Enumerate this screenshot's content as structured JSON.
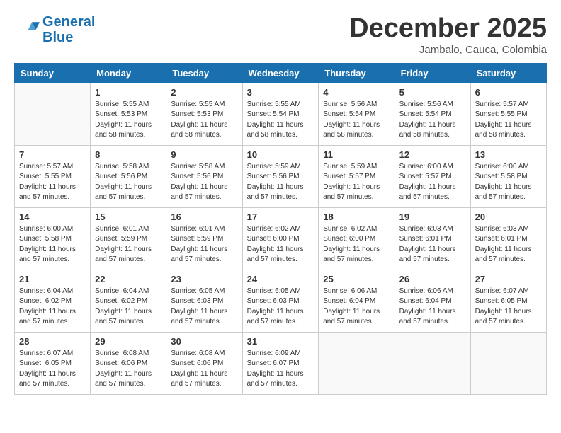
{
  "header": {
    "logo_line1": "General",
    "logo_line2": "Blue",
    "month_title": "December 2025",
    "location": "Jambalo, Cauca, Colombia"
  },
  "weekdays": [
    "Sunday",
    "Monday",
    "Tuesday",
    "Wednesday",
    "Thursday",
    "Friday",
    "Saturday"
  ],
  "weeks": [
    [
      {
        "day": "",
        "info": ""
      },
      {
        "day": "1",
        "info": "Sunrise: 5:55 AM\nSunset: 5:53 PM\nDaylight: 11 hours\nand 58 minutes."
      },
      {
        "day": "2",
        "info": "Sunrise: 5:55 AM\nSunset: 5:53 PM\nDaylight: 11 hours\nand 58 minutes."
      },
      {
        "day": "3",
        "info": "Sunrise: 5:55 AM\nSunset: 5:54 PM\nDaylight: 11 hours\nand 58 minutes."
      },
      {
        "day": "4",
        "info": "Sunrise: 5:56 AM\nSunset: 5:54 PM\nDaylight: 11 hours\nand 58 minutes."
      },
      {
        "day": "5",
        "info": "Sunrise: 5:56 AM\nSunset: 5:54 PM\nDaylight: 11 hours\nand 58 minutes."
      },
      {
        "day": "6",
        "info": "Sunrise: 5:57 AM\nSunset: 5:55 PM\nDaylight: 11 hours\nand 58 minutes."
      }
    ],
    [
      {
        "day": "7",
        "info": "Sunrise: 5:57 AM\nSunset: 5:55 PM\nDaylight: 11 hours\nand 57 minutes."
      },
      {
        "day": "8",
        "info": "Sunrise: 5:58 AM\nSunset: 5:56 PM\nDaylight: 11 hours\nand 57 minutes."
      },
      {
        "day": "9",
        "info": "Sunrise: 5:58 AM\nSunset: 5:56 PM\nDaylight: 11 hours\nand 57 minutes."
      },
      {
        "day": "10",
        "info": "Sunrise: 5:59 AM\nSunset: 5:56 PM\nDaylight: 11 hours\nand 57 minutes."
      },
      {
        "day": "11",
        "info": "Sunrise: 5:59 AM\nSunset: 5:57 PM\nDaylight: 11 hours\nand 57 minutes."
      },
      {
        "day": "12",
        "info": "Sunrise: 6:00 AM\nSunset: 5:57 PM\nDaylight: 11 hours\nand 57 minutes."
      },
      {
        "day": "13",
        "info": "Sunrise: 6:00 AM\nSunset: 5:58 PM\nDaylight: 11 hours\nand 57 minutes."
      }
    ],
    [
      {
        "day": "14",
        "info": "Sunrise: 6:00 AM\nSunset: 5:58 PM\nDaylight: 11 hours\nand 57 minutes."
      },
      {
        "day": "15",
        "info": "Sunrise: 6:01 AM\nSunset: 5:59 PM\nDaylight: 11 hours\nand 57 minutes."
      },
      {
        "day": "16",
        "info": "Sunrise: 6:01 AM\nSunset: 5:59 PM\nDaylight: 11 hours\nand 57 minutes."
      },
      {
        "day": "17",
        "info": "Sunrise: 6:02 AM\nSunset: 6:00 PM\nDaylight: 11 hours\nand 57 minutes."
      },
      {
        "day": "18",
        "info": "Sunrise: 6:02 AM\nSunset: 6:00 PM\nDaylight: 11 hours\nand 57 minutes."
      },
      {
        "day": "19",
        "info": "Sunrise: 6:03 AM\nSunset: 6:01 PM\nDaylight: 11 hours\nand 57 minutes."
      },
      {
        "day": "20",
        "info": "Sunrise: 6:03 AM\nSunset: 6:01 PM\nDaylight: 11 hours\nand 57 minutes."
      }
    ],
    [
      {
        "day": "21",
        "info": "Sunrise: 6:04 AM\nSunset: 6:02 PM\nDaylight: 11 hours\nand 57 minutes."
      },
      {
        "day": "22",
        "info": "Sunrise: 6:04 AM\nSunset: 6:02 PM\nDaylight: 11 hours\nand 57 minutes."
      },
      {
        "day": "23",
        "info": "Sunrise: 6:05 AM\nSunset: 6:03 PM\nDaylight: 11 hours\nand 57 minutes."
      },
      {
        "day": "24",
        "info": "Sunrise: 6:05 AM\nSunset: 6:03 PM\nDaylight: 11 hours\nand 57 minutes."
      },
      {
        "day": "25",
        "info": "Sunrise: 6:06 AM\nSunset: 6:04 PM\nDaylight: 11 hours\nand 57 minutes."
      },
      {
        "day": "26",
        "info": "Sunrise: 6:06 AM\nSunset: 6:04 PM\nDaylight: 11 hours\nand 57 minutes."
      },
      {
        "day": "27",
        "info": "Sunrise: 6:07 AM\nSunset: 6:05 PM\nDaylight: 11 hours\nand 57 minutes."
      }
    ],
    [
      {
        "day": "28",
        "info": "Sunrise: 6:07 AM\nSunset: 6:05 PM\nDaylight: 11 hours\nand 57 minutes."
      },
      {
        "day": "29",
        "info": "Sunrise: 6:08 AM\nSunset: 6:06 PM\nDaylight: 11 hours\nand 57 minutes."
      },
      {
        "day": "30",
        "info": "Sunrise: 6:08 AM\nSunset: 6:06 PM\nDaylight: 11 hours\nand 57 minutes."
      },
      {
        "day": "31",
        "info": "Sunrise: 6:09 AM\nSunset: 6:07 PM\nDaylight: 11 hours\nand 57 minutes."
      },
      {
        "day": "",
        "info": ""
      },
      {
        "day": "",
        "info": ""
      },
      {
        "day": "",
        "info": ""
      }
    ]
  ]
}
